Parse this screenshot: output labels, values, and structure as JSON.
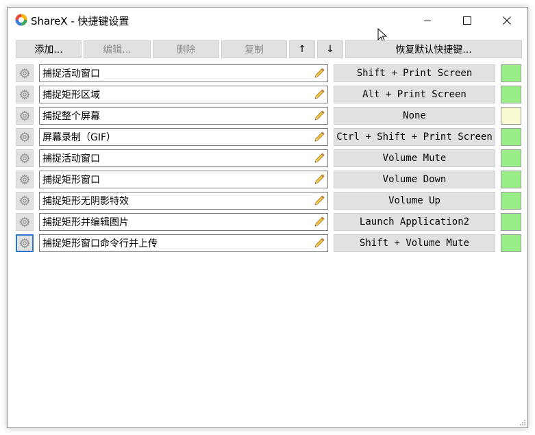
{
  "window": {
    "title": "ShareX - 快捷键设置",
    "controls": {
      "minimize": "minimize",
      "maximize": "maximize",
      "close": "close"
    }
  },
  "toolbar": {
    "add_label": "添加...",
    "edit_label": "编辑...",
    "delete_label": "删除",
    "copy_label": "复制",
    "move_up_label": "↑",
    "move_down_label": "↓",
    "restore_label": "恢复默认快捷键..."
  },
  "hotkeys": [
    {
      "name": "捕捉活动窗口",
      "hotkey": "Shift + Print Screen",
      "status_color": "#99ee88"
    },
    {
      "name": "捕捉矩形区域",
      "hotkey": "Alt + Print Screen",
      "status_color": "#99ee88"
    },
    {
      "name": "捕捉整个屏幕",
      "hotkey": "None",
      "status_color": "#fafad2"
    },
    {
      "name": "屏幕录制（GIF）",
      "hotkey": "Ctrl + Shift + Print Screen",
      "status_color": "#99ee88"
    },
    {
      "name": "捕捉活动窗口",
      "hotkey": "Volume Mute",
      "status_color": "#99ee88"
    },
    {
      "name": "捕捉矩形窗口",
      "hotkey": "Volume Down",
      "status_color": "#99ee88"
    },
    {
      "name": "捕捉矩形无阴影特效",
      "hotkey": "Volume Up",
      "status_color": "#99ee88"
    },
    {
      "name": "捕捉矩形并编辑图片",
      "hotkey": "Launch Application2",
      "status_color": "#99ee88"
    },
    {
      "name": "捕捉矩形窗口命令行并上传",
      "hotkey": "Shift + Volume Mute",
      "status_color": "#99ee88"
    }
  ],
  "icons": {
    "app": "sharex-logo-icon",
    "settings": "gear-icon",
    "edit": "pencil-icon"
  }
}
